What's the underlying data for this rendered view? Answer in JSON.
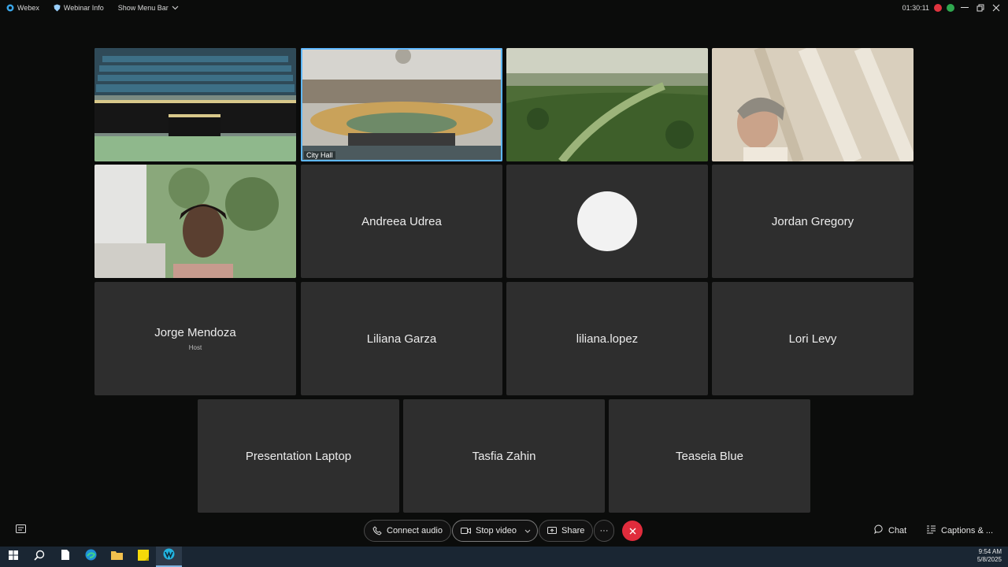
{
  "topbar": {
    "app_name": "Webex",
    "webinar_info": "Webinar Info",
    "show_menu_bar": "Show Menu Bar",
    "timer": "01:30:11"
  },
  "tiles": [
    {
      "type": "video",
      "label": ""
    },
    {
      "type": "video",
      "label": "City Hall"
    },
    {
      "type": "video",
      "label": ""
    },
    {
      "type": "video",
      "label": ""
    },
    {
      "type": "video",
      "label": ""
    },
    {
      "type": "name",
      "name": "Andreea Udrea"
    },
    {
      "type": "avatar"
    },
    {
      "type": "name",
      "name": "Jordan Gregory"
    },
    {
      "type": "name",
      "name": "Jorge Mendoza",
      "sub": "Host"
    },
    {
      "type": "name",
      "name": "Liliana Garza"
    },
    {
      "type": "name",
      "name": "liliana.lopez"
    },
    {
      "type": "name",
      "name": "Lori Levy"
    },
    {
      "type": "name",
      "name": "Presentation Laptop"
    },
    {
      "type": "name",
      "name": "Tasfia Zahin"
    },
    {
      "type": "name",
      "name": "Teaseia Blue"
    }
  ],
  "controls": {
    "connect_audio": "Connect audio",
    "stop_video": "Stop video",
    "share": "Share",
    "more": "···",
    "chat": "Chat",
    "captions": "Captions & ..."
  },
  "taskbar": {
    "time": "9:54 AM",
    "date": "5/8/2025"
  },
  "colors": {
    "tile_bg": "#2e2e2e",
    "active_outline": "#5fb8ff",
    "end_button": "#e02c3c",
    "taskbar_bg": "#1a2633"
  }
}
